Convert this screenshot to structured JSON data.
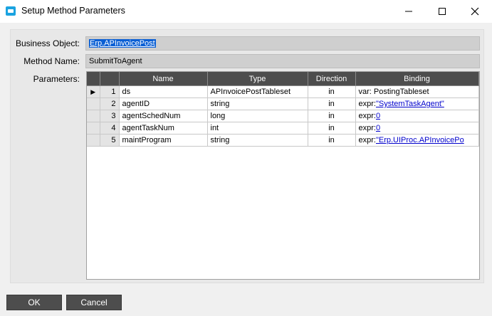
{
  "window": {
    "title": "Setup Method Parameters"
  },
  "form": {
    "business_object_label": "Business Object:",
    "business_object_value": "Erp.APInvoicePost",
    "method_name_label": "Method Name:",
    "method_name_value": "SubmitToAgent",
    "parameters_label": "Parameters:"
  },
  "grid": {
    "columns": [
      "Name",
      "Type",
      "Direction",
      "Binding"
    ],
    "current_row_marker": "▶",
    "rows": [
      {
        "num": "1",
        "name": "ds",
        "type": "APInvoicePostTableset",
        "direction": "in",
        "binding_prefix": "",
        "binding": "var: PostingTableset"
      },
      {
        "num": "2",
        "name": "agentID",
        "type": "string",
        "direction": "in",
        "binding_prefix": "expr:",
        "binding": "\"SystemTaskAgent\""
      },
      {
        "num": "3",
        "name": "agentSchedNum",
        "type": "long",
        "direction": "in",
        "binding_prefix": "expr:",
        "binding": "0"
      },
      {
        "num": "4",
        "name": "agentTaskNum",
        "type": "int",
        "direction": "in",
        "binding_prefix": "expr:",
        "binding": "0"
      },
      {
        "num": "5",
        "name": "maintProgram",
        "type": "string",
        "direction": "in",
        "binding_prefix": "expr:",
        "binding": "\"Erp.UIProc.APInvoicePo"
      }
    ]
  },
  "buttons": {
    "ok": "OK",
    "cancel": "Cancel"
  }
}
